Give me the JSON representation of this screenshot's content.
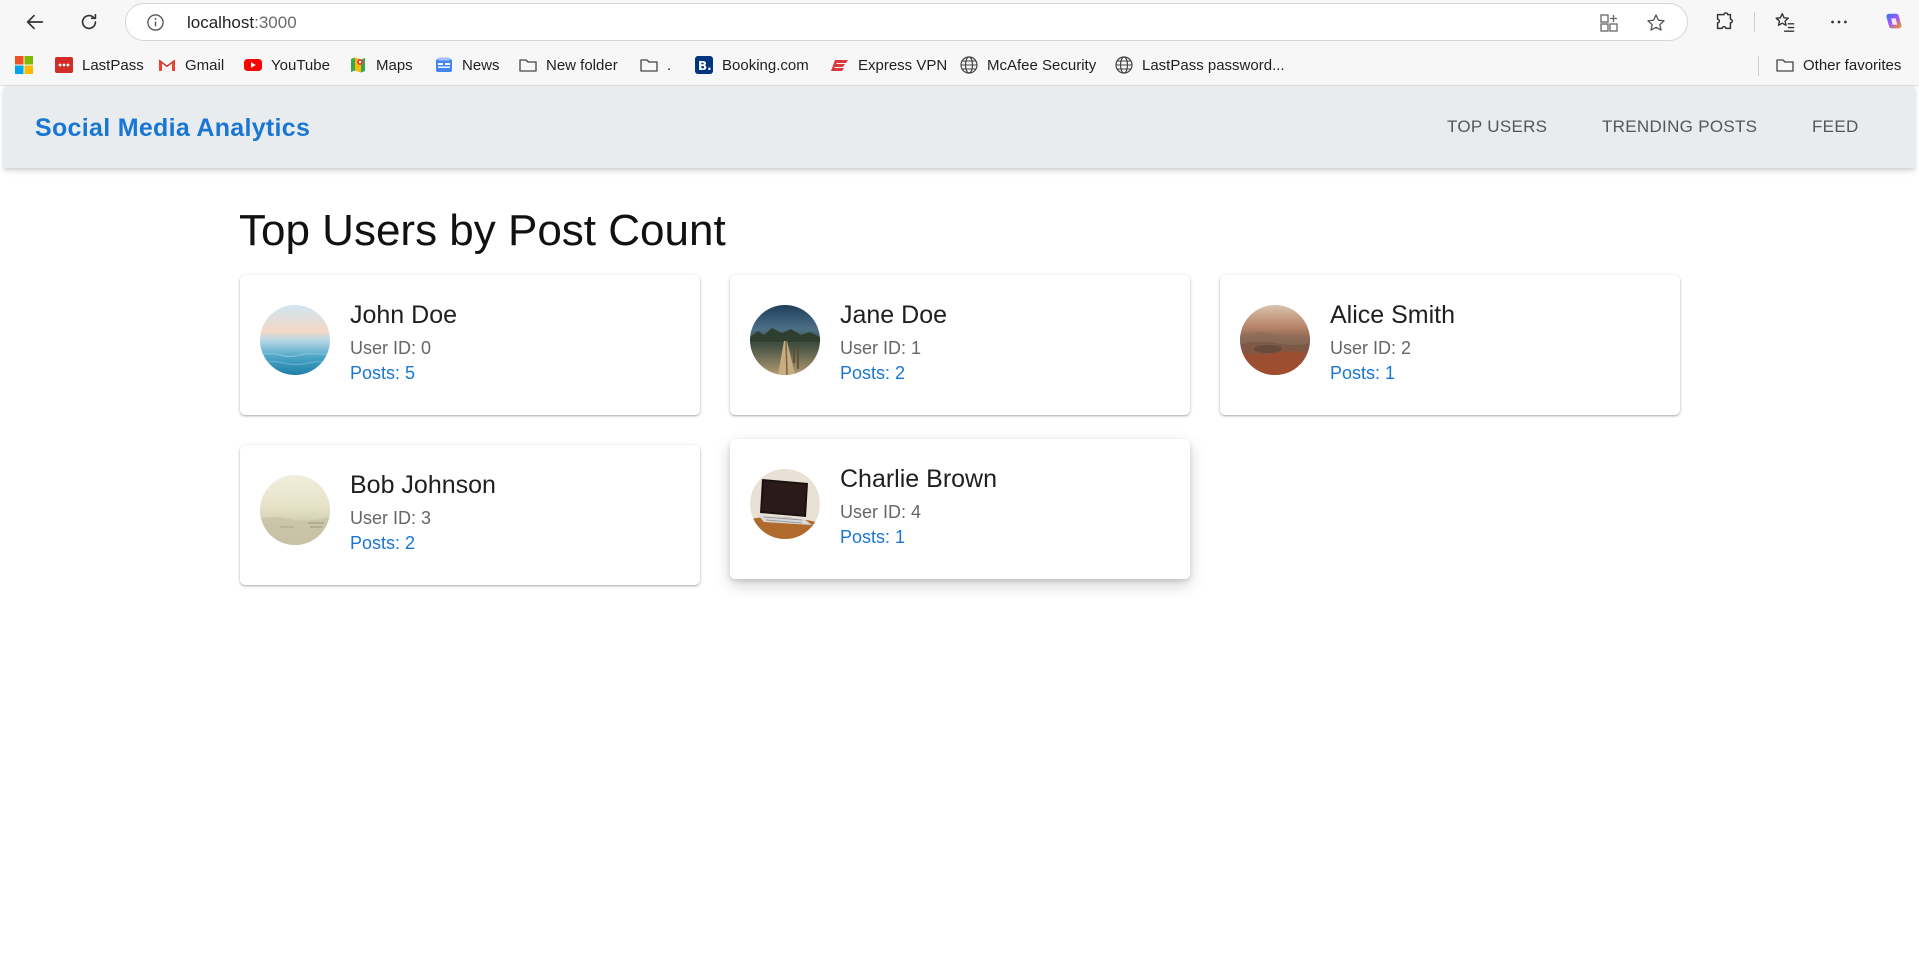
{
  "browser": {
    "url_host": "localhost",
    "url_port": ":3000",
    "bookmarks": [
      {
        "label": "LastPass",
        "icon": "lastpass-icon"
      },
      {
        "label": "Gmail",
        "icon": "gmail-icon"
      },
      {
        "label": "YouTube",
        "icon": "youtube-icon"
      },
      {
        "label": "Maps",
        "icon": "maps-icon"
      },
      {
        "label": "News",
        "icon": "news-icon"
      },
      {
        "label": "New folder",
        "icon": "folder-icon"
      },
      {
        "label": ".",
        "icon": "folder-icon"
      },
      {
        "label": "Booking.com",
        "icon": "booking-icon"
      },
      {
        "label": "Express VPN",
        "icon": "expressvpn-icon"
      },
      {
        "label": "McAfee Security",
        "icon": "globe-icon"
      },
      {
        "label": "LastPass password...",
        "icon": "globe-icon"
      }
    ],
    "other_favorites": "Other favorites"
  },
  "app": {
    "brand": "Social Media Analytics",
    "nav": [
      "Top Users",
      "Trending Posts",
      "Feed"
    ],
    "page_title": "Top Users by Post Count",
    "accent_color": "#1976d2",
    "users": [
      {
        "name": "John Doe",
        "user_id": "User ID: 0",
        "posts": "Posts: 5",
        "avatar": "ocean-photo"
      },
      {
        "name": "Jane Doe",
        "user_id": "User ID: 1",
        "posts": "Posts: 2",
        "avatar": "pier-photo"
      },
      {
        "name": "Alice Smith",
        "user_id": "User ID: 2",
        "posts": "Posts: 1",
        "avatar": "desert-aerial-photo"
      },
      {
        "name": "Bob Johnson",
        "user_id": "User ID: 3",
        "posts": "Posts: 2",
        "avatar": "foggy-landscape-photo"
      },
      {
        "name": "Charlie Brown",
        "user_id": "User ID: 4",
        "posts": "Posts: 1",
        "avatar": "laptop-photo"
      }
    ]
  }
}
